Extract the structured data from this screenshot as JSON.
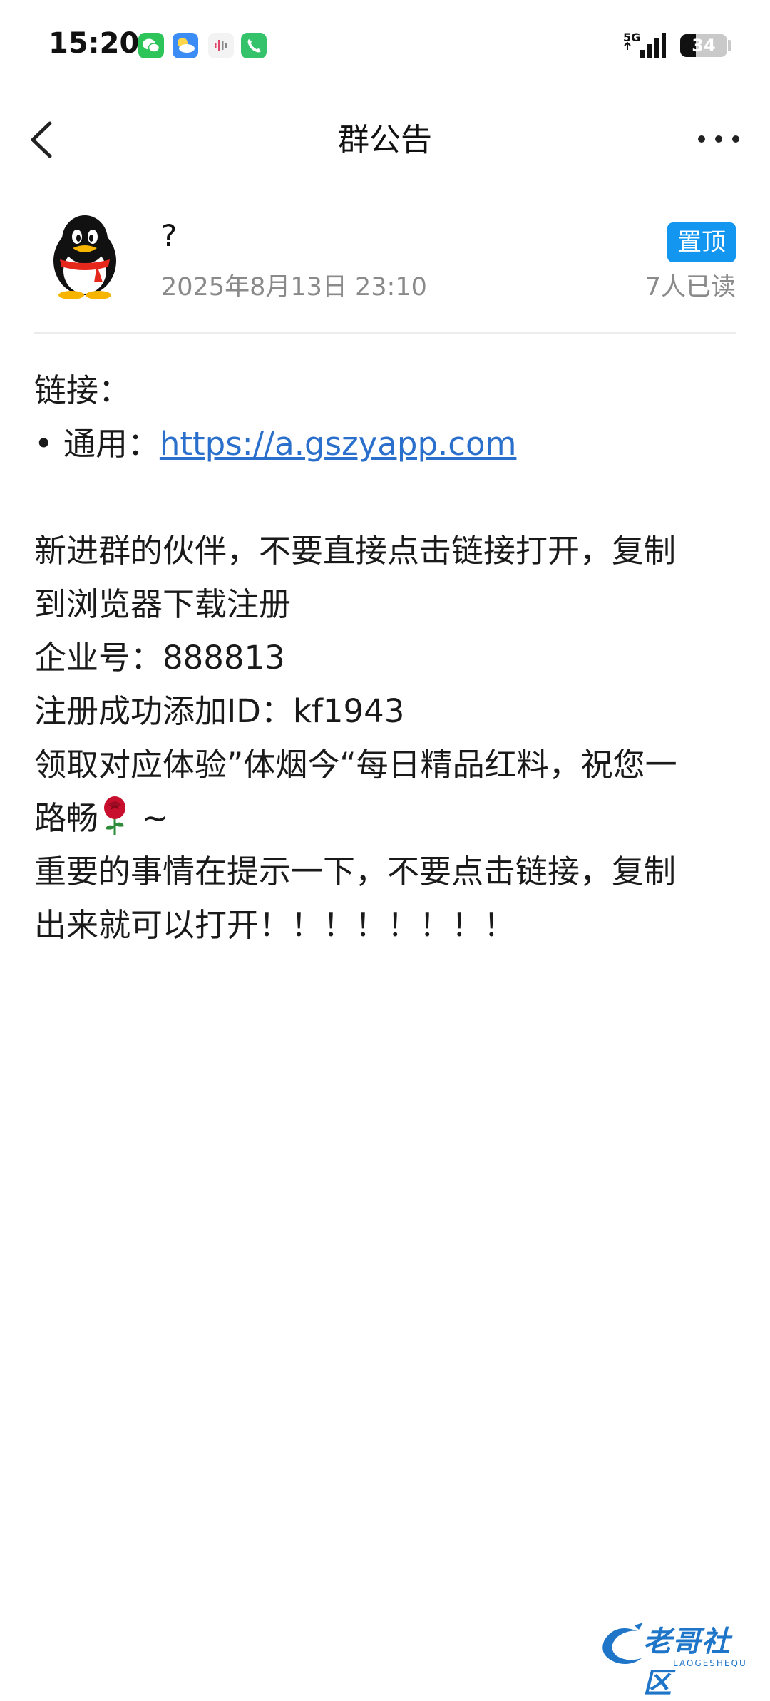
{
  "status_bar": {
    "time": "15:20",
    "network": "5G",
    "battery": "34",
    "battery_level": 0.34,
    "app_icons": [
      "wechat-icon",
      "weather-icon",
      "voice-recorder-icon",
      "phone-icon"
    ]
  },
  "nav": {
    "title": "群公告"
  },
  "announcement": {
    "author": "?",
    "timestamp": "2025年8月13日 23:10",
    "pin_label": "置顶",
    "read_count": "7人已读",
    "lines": {
      "l1": "链接：",
      "l2_prefix": "• 通用：",
      "l2_link": "https://a.gszyapp.com",
      "l3": "新进群的伙伴，不要直接点击链接打开，复制",
      "l4": "到浏览器下载注册",
      "l5": "企业号：888813",
      "l6": "注册成功添加ID：kf1943",
      "l7": "领取对应体验”体烟今“每日精品红料，祝您一",
      "l8_prefix": "路畅",
      "l8_suffix": " ~",
      "l9": "重要的事情在提示一下，不要点击链接，复制",
      "l10": "出来就可以打开！！！！！！！！"
    }
  },
  "watermark": {
    "text": "老哥社区",
    "sub": "LAOGESHEQU"
  },
  "colors": {
    "accent": "#1296f0",
    "link": "#2a6fcc",
    "muted": "#8a8a8a"
  }
}
